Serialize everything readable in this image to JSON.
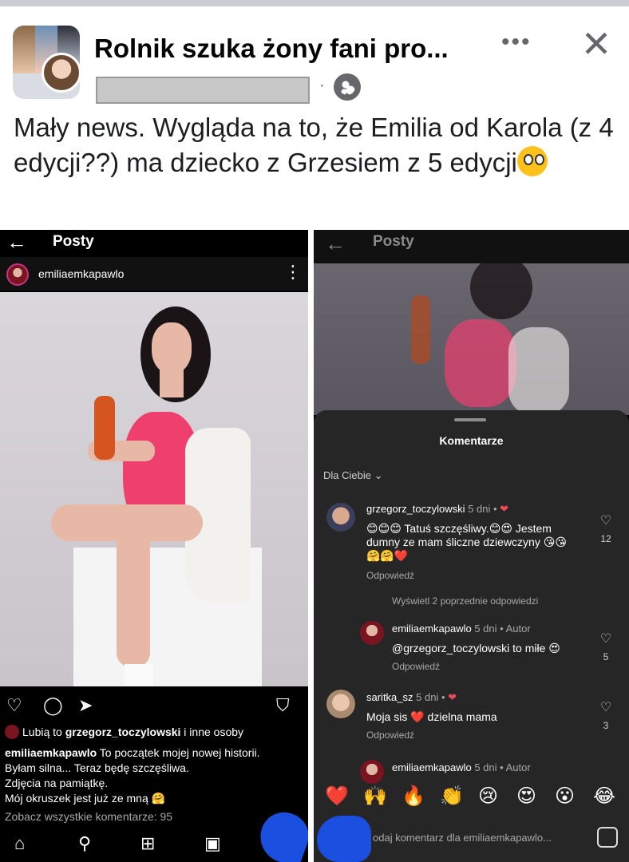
{
  "post": {
    "group_title": "Rolnik szuka żony fani pro...",
    "body": "Mały news. Wygląda na to, że Emilia od Karola (z 4 edycji??) ma dziecko z Grzesiem z 5 edycji",
    "emoji": "flushed-face-emoji"
  },
  "left": {
    "header_title": "Posty",
    "username": "emiliaemkapawlo",
    "likes_prefix": "Lubią to ",
    "likes_user": "grzegorz_toczylowski",
    "likes_suffix": " i inne osoby",
    "caption_user": "emiliaemkapawlo",
    "caption_line1": " To początek mojej nowej historii.",
    "caption_line2": "Byłam silna... Teraz będę szczęśliwa.",
    "caption_line3": "Zdjęcia na pamiątkę.",
    "caption_line4": "Mój okruszek jest już ze mną 🤗",
    "view_all_comments": "Zobacz wszystkie komentarze: 95"
  },
  "right": {
    "header_title": "Posty",
    "sheet_title": "Komentarze",
    "sort_label": "Dla Ciebie ⌄",
    "comments": [
      {
        "user": "grzegorz_toczylowski",
        "meta": " 5 dni • ",
        "text": "😊😊😊 Tatuś szczęśliwy.😊😍 Jestem dumny ze mam śliczne dziewczyny 😘😘 🤗🤗❤️",
        "reply": "Odpowiedź",
        "likes": "12"
      },
      {
        "user": "emiliaemkapawlo",
        "meta": " 5 dni • Autor",
        "text": "@grzegorz_toczylowski to miłe 😍",
        "reply": "Odpowiedź",
        "likes": "5"
      },
      {
        "user": "saritka_sz",
        "meta": " 5 dni • ",
        "text": "Moja sis ❤️ dzielna mama",
        "reply": "Odpowiedź",
        "likes": "3"
      },
      {
        "user": "emiliaemkapawlo",
        "meta": " 5 dni • Autor"
      }
    ],
    "view_previous": "Wyświetl 2 poprzednie odpowiedzi",
    "quick_emojis": [
      "❤️",
      "🙌",
      "🔥",
      "👏",
      "😢",
      "😍",
      "😮",
      "😂"
    ],
    "add_comment_placeholder": "odaj komentarz dla emiliaemkapawlo..."
  },
  "colors": {
    "ig_background": "#000000",
    "sheet_background": "#262626",
    "accent_red": "#ed4956",
    "scribble_blue": "#1a4fe0"
  }
}
